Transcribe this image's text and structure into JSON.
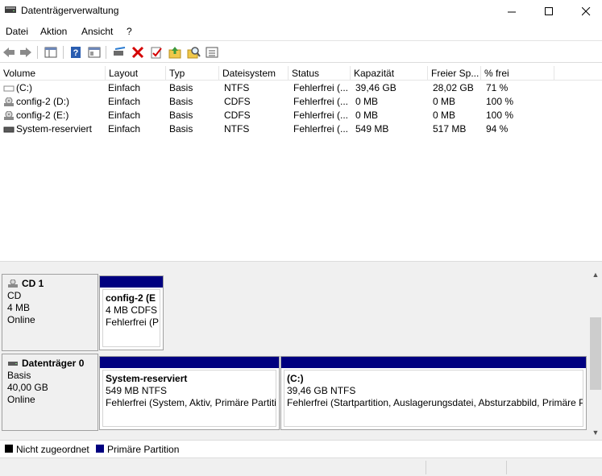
{
  "window": {
    "title": "Datenträgerverwaltung"
  },
  "menu": [
    "Datei",
    "Aktion",
    "Ansicht",
    "?"
  ],
  "toolbar": {
    "buttons": [
      "back-icon",
      "forward-icon",
      "console-tree-icon",
      "help-icon",
      "properties-view-icon",
      "connect-icon",
      "delete-icon",
      "check-icon",
      "up-folder-icon",
      "find-icon",
      "list-icon"
    ]
  },
  "list": {
    "columns": [
      "Volume",
      "Layout",
      "Typ",
      "Dateisystem",
      "Status",
      "Kapazität",
      "Freier Sp...",
      "% frei"
    ],
    "rows": [
      {
        "volume": "(C:)",
        "layout": "Einfach",
        "typ": "Basis",
        "fs": "NTFS",
        "status": "Fehlerfrei (...",
        "kapazitaet": "39,46 GB",
        "frei": "28,02 GB",
        "prozent": "71 %",
        "icon": "volume-icon"
      },
      {
        "volume": "config-2 (D:)",
        "layout": "Einfach",
        "typ": "Basis",
        "fs": "CDFS",
        "status": "Fehlerfrei (...",
        "kapazitaet": "0 MB",
        "frei": "0 MB",
        "prozent": "100 %",
        "icon": "cd-drive-icon"
      },
      {
        "volume": "config-2 (E:)",
        "layout": "Einfach",
        "typ": "Basis",
        "fs": "CDFS",
        "status": "Fehlerfrei (...",
        "kapazitaet": "0 MB",
        "frei": "0 MB",
        "prozent": "100 %",
        "icon": "cd-drive-icon"
      },
      {
        "volume": "System-reserviert",
        "layout": "Einfach",
        "typ": "Basis",
        "fs": "NTFS",
        "status": "Fehlerfrei (...",
        "kapazitaet": "549 MB",
        "frei": "517 MB",
        "prozent": "94 %",
        "icon": "volume-icon"
      }
    ]
  },
  "disks": [
    {
      "name": "CD 1",
      "type": "CD",
      "size": "4 MB",
      "state": "Online",
      "partitions": [
        {
          "name": "config-2  (E",
          "size_fs": "4 MB CDFS",
          "status": "Fehlerfrei (P"
        }
      ]
    },
    {
      "name": "Datenträger 0",
      "type": "Basis",
      "size": "40,00 GB",
      "state": "Online",
      "partitions": [
        {
          "name": "System-reserviert",
          "size_fs": "549 MB NTFS",
          "status": "Fehlerfrei (System, Aktiv, Primäre Partiti"
        },
        {
          "name": "(C:)",
          "size_fs": "39,46 GB NTFS",
          "status": "Fehlerfrei (Startpartition, Auslagerungsdatei, Absturzabbild, Primäre P"
        }
      ]
    }
  ],
  "legend": [
    {
      "label": "Nicht zugeordnet",
      "color": "#000000"
    },
    {
      "label": "Primäre Partition",
      "color": "#000080"
    }
  ]
}
